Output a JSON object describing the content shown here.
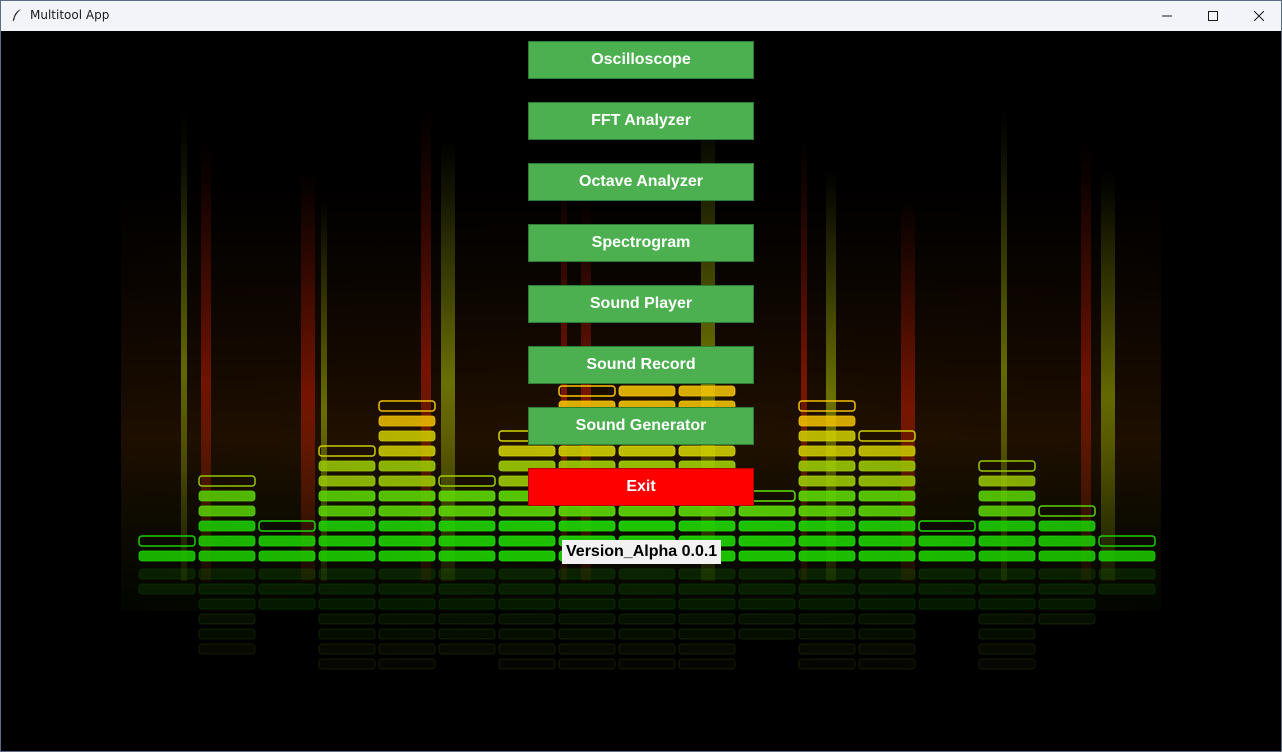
{
  "window": {
    "title": "Multitool App",
    "icon": "feather-icon",
    "controls": [
      "minimize-icon",
      "maximize-icon",
      "close-icon"
    ]
  },
  "menu": {
    "buttons": [
      {
        "label": "Oscilloscope"
      },
      {
        "label": "FFT Analyzer"
      },
      {
        "label": "Octave Analyzer"
      },
      {
        "label": "Spectrogram"
      },
      {
        "label": "Sound Player"
      },
      {
        "label": "Sound Record"
      },
      {
        "label": "Sound Generator"
      }
    ],
    "exit_label": "Exit"
  },
  "version": "Version_Alpha 0.0.1",
  "colors": {
    "button_green": "#4caf50",
    "exit_red": "#ff0000"
  }
}
